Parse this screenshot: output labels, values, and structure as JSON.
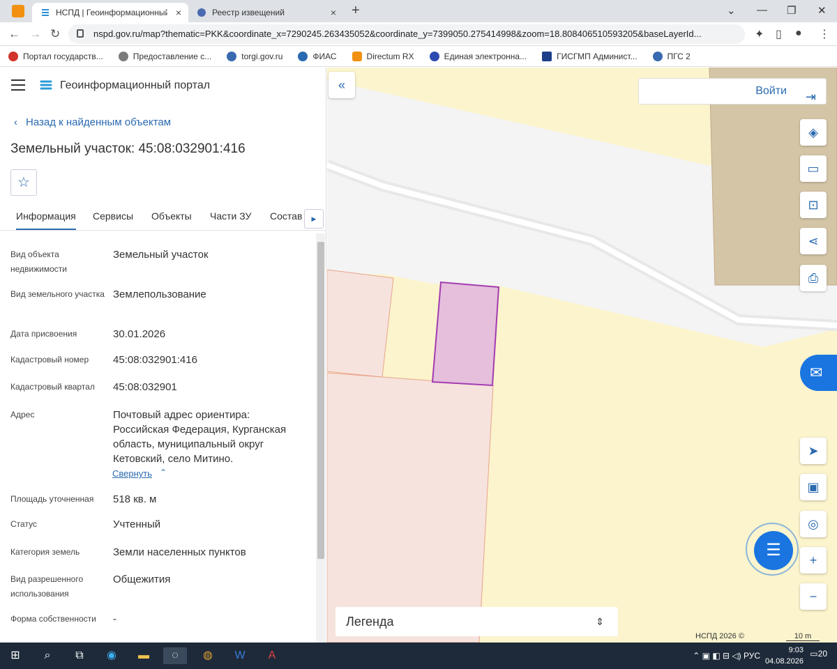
{
  "browser": {
    "tabs": [
      {
        "title": "НСПД | Геоинформационный п",
        "close": "×"
      },
      {
        "title": "Реестр извещений",
        "close": "×"
      }
    ],
    "new_tab": "+",
    "url": "nspd.gov.ru/map?thematic=PKK&coordinate_x=7290245.263435052&coordinate_y=7399050.275414998&zoom=18.808406510593205&baseLayerId...",
    "bookmarks": [
      {
        "label": "Портал государств...",
        "color": "#d0342c"
      },
      {
        "label": "Предоставление с...",
        "color": "#7a7a7a"
      },
      {
        "label": "torgi.gov.ru",
        "color": "#3a6ab0"
      },
      {
        "label": "ФИАС",
        "color": "#2a6ab0"
      },
      {
        "label": "Directum RX",
        "color": "#f29111"
      },
      {
        "label": "Единая электронна...",
        "color": "#2a4ab0"
      },
      {
        "label": "ГИСГМП Админист...",
        "color": "#1d3f8a"
      },
      {
        "label": "ПГС 2",
        "color": "#3a6ab0"
      }
    ]
  },
  "panel": {
    "portal_title": "Геоинформационный портал",
    "back_link": "Назад к найденным объектам",
    "object_title": "Земельный участок: 45:08:032901:416",
    "tabs": [
      "Информация",
      "Сервисы",
      "Объекты",
      "Части ЗУ",
      "Состав"
    ],
    "rows": [
      {
        "label": "Вид объекта недвижимости",
        "value": "Земельный участок"
      },
      {
        "label": "Вид земельного участка",
        "value": "Землепользование"
      },
      {
        "label": "Дата присвоения",
        "value": "30.01.2026"
      },
      {
        "label": "Кадастровый номер",
        "value": "45:08:032901:416"
      },
      {
        "label": "Кадастровый квартал",
        "value": "45:08:032901"
      },
      {
        "label": "Адрес",
        "value": "Почтовый адрес ориентира: Российская Федерация, Курганская область, муниципальный округ Кетовский, село Митино."
      },
      {
        "label": "Площадь уточненная",
        "value": "518 кв. м"
      },
      {
        "label": "Статус",
        "value": "Учтенный"
      },
      {
        "label": "Категория земель",
        "value": "Земли населенных пунктов"
      },
      {
        "label": "Вид разрешенного использования",
        "value": "Общежития"
      },
      {
        "label": "Форма собственности",
        "value": "-"
      }
    ],
    "collapse_link": "Свернуть"
  },
  "map": {
    "login": "Войти",
    "legend": "Легенда",
    "copyright": "НСПД 2026 ©",
    "scale": "10 m",
    "colors": {
      "background": "#fbf4cd",
      "road": "#f4f4f4",
      "parcel_selected": "#e5bfdc",
      "parcel_outline": "#a33bb0",
      "neighbor_parcel": "#f6e3dd",
      "building": "#d5c5a7",
      "accent": "#1a75e0"
    }
  },
  "taskbar": {
    "lang": "РУС",
    "time": "9:03",
    "date": "04.08.2026",
    "notifications": "20"
  }
}
